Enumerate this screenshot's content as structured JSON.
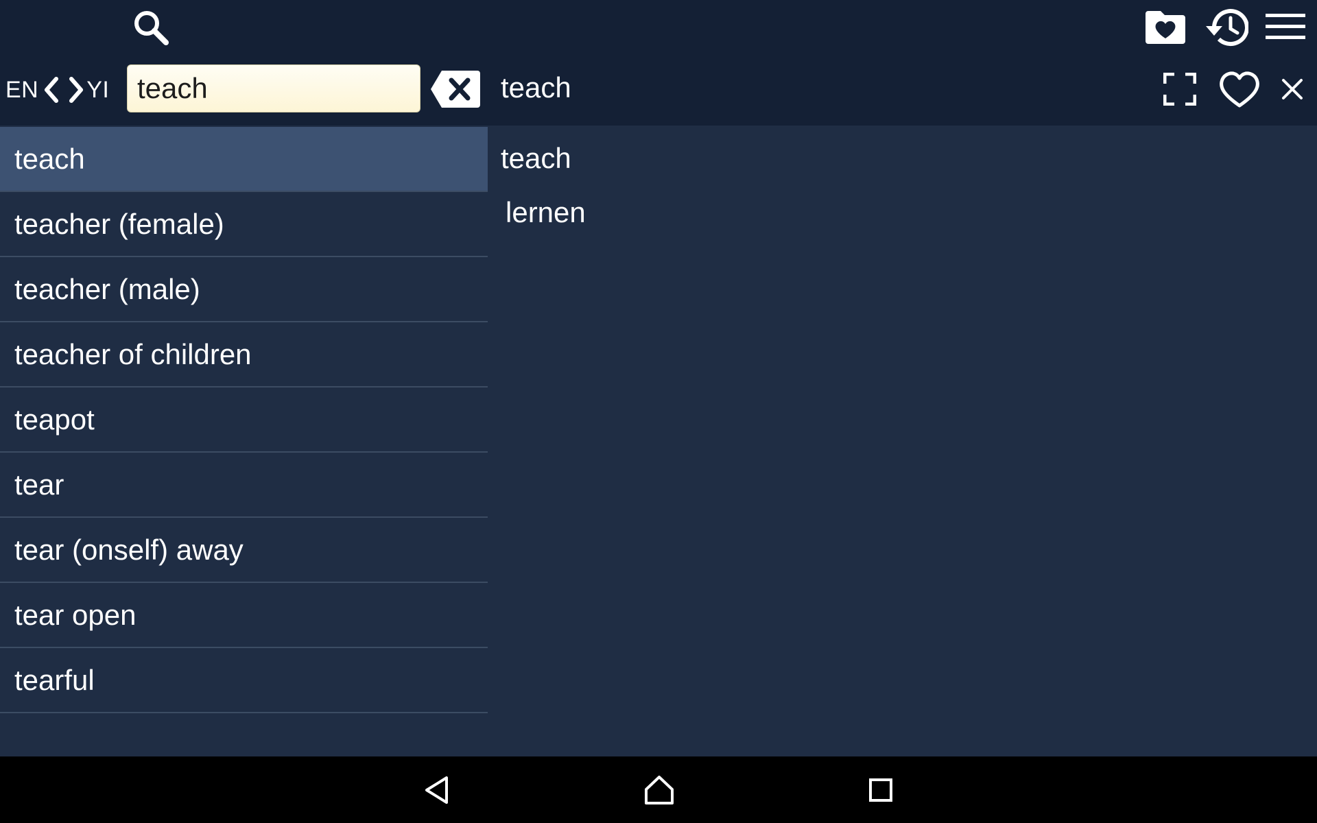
{
  "toolbar": {
    "icons": [
      "search-icon",
      "favorites-folder-icon",
      "history-icon",
      "menu-icon"
    ]
  },
  "language": {
    "source": "EN",
    "target": "YI"
  },
  "search": {
    "value": "teach"
  },
  "detail_header": {
    "title": "teach",
    "icons": [
      "fullscreen-icon",
      "heart-icon",
      "close-icon"
    ]
  },
  "word_list": {
    "selected_index": 0,
    "items": [
      {
        "label": "teach"
      },
      {
        "label": "teacher (female)"
      },
      {
        "label": "teacher (male)"
      },
      {
        "label": "teacher of children"
      },
      {
        "label": "teapot"
      },
      {
        "label": "tear"
      },
      {
        "label": "tear (onself) away"
      },
      {
        "label": "tear open"
      },
      {
        "label": "tearful"
      }
    ]
  },
  "detail": {
    "word": "teach",
    "translation": "lernen"
  },
  "navbar": {
    "icons": [
      "back-icon",
      "home-icon",
      "recents-icon"
    ]
  },
  "colors": {
    "topbar_bg": "#142035",
    "content_bg": "#1f2d44",
    "selected_row_bg": "#3d5272",
    "input_bg": "#fdf5d6",
    "navbar_bg": "#000000"
  }
}
